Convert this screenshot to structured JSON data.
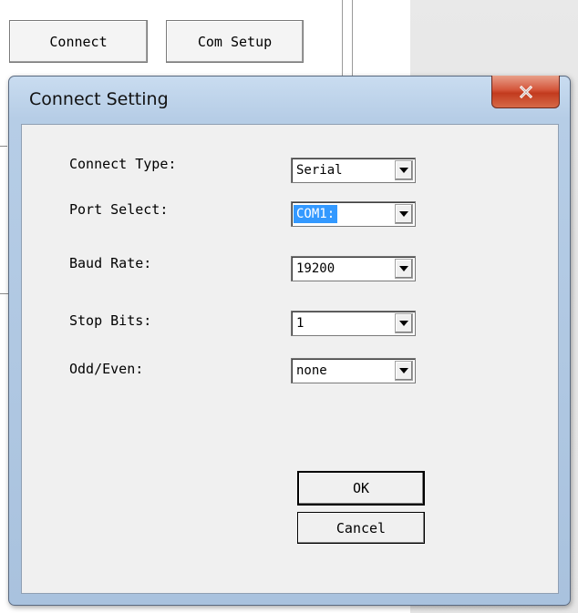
{
  "background": {
    "buttons": {
      "connect_label": "Connect",
      "com_setup_label": "Com Setup"
    }
  },
  "dialog": {
    "title": "Connect Setting",
    "close_icon": "close-x-icon",
    "fields": [
      {
        "label": "Connect Type:",
        "value": "Serial",
        "selected": false
      },
      {
        "label": "Port Select:",
        "value": "COM1:",
        "selected": true
      },
      {
        "label": "Baud Rate:",
        "value": "19200",
        "selected": false
      },
      {
        "label": "Stop Bits:",
        "value": "1",
        "selected": false
      },
      {
        "label": "Odd/Even:",
        "value": "none",
        "selected": false
      }
    ],
    "ok_label": "OK",
    "cancel_label": "Cancel"
  },
  "colors": {
    "selection_highlight": "#3399ff",
    "close_button": "#c23a1e",
    "titlebar": "#b6cde6"
  }
}
